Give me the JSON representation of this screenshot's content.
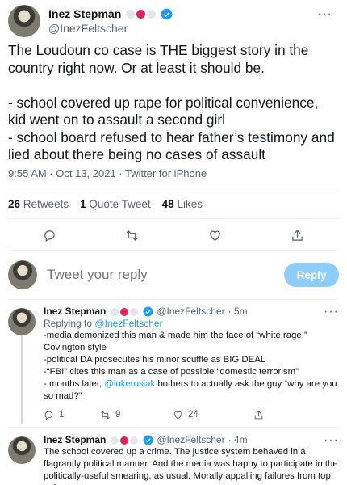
{
  "colors": {
    "accent": "#1d9bf0",
    "muted": "#536471",
    "reply_button_bg": "#8ecdf8"
  },
  "main_tweet": {
    "author_name": "Inez Stepman",
    "author_handle": "@InezFeltscher",
    "emoji_circles": [
      "#e1e8ed",
      "#e0245e",
      "#e1e8ed"
    ],
    "text": "The Loudoun co case is THE biggest story in the country right now. Or at least it should be.\n\n- school covered up rape for political convenience, kid went on to assault a second girl\n- school board refused to hear father’s testimony and lied about there being no cases of assault",
    "timestamp": "9:55 AM · Oct 13, 2021 · Twitter for iPhone",
    "stats": {
      "retweets_count": "26",
      "retweets_label": "Retweets",
      "quotes_count": "1",
      "quotes_label": "Quote Tweet",
      "likes_count": "48",
      "likes_label": "Likes"
    },
    "action_icons": [
      "reply-icon",
      "retweet-icon",
      "like-icon",
      "share-icon"
    ]
  },
  "composer": {
    "placeholder": "Tweet your reply",
    "reply_label": "Reply"
  },
  "replies": [
    {
      "author_name": "Inez Stepman",
      "author_handle": "@InezFeltscher",
      "time": "· 5m",
      "replying_prefix": "Replying to ",
      "replying_to": "@InezFeltscher",
      "text_before_mention": "-media demonized this man & made him the face of “white rage,” Covington style\n-political DA prosecutes his minor scuffle as BIG DEAL\n-“FBI” cites this man as a case of possible “domestic terrorism”\n- months later, ",
      "mention": "@lukerosiak",
      "text_after_mention": " bothers to actually ask the guy “why are you so mad?”",
      "reply_count": "1",
      "retweet_count": "9",
      "like_count": "24"
    },
    {
      "author_name": "Inez Stepman",
      "author_handle": "@InezFeltscher",
      "time": "· 4m",
      "text": "The school covered up a crime. The justice system behaved in a flagrantly political manner. And the media was happy to participate in the politically-useful smearing, as usual. Morally appalling failures from top to bottom."
    }
  ]
}
